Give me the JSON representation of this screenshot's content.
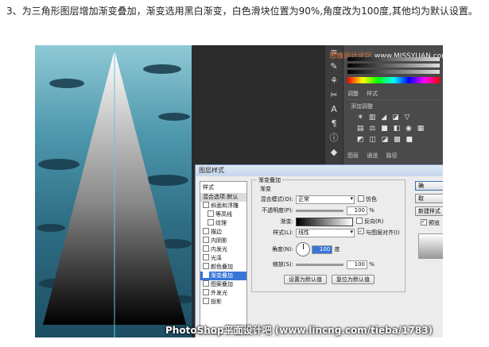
{
  "caption": "3、为三角形图层增加渐变叠加，渐变选用黑白渐变，白色滑块位置为90%,角度改为100度,其他均为默认设置。",
  "watermark_top": {
    "brand": "思缘设计论坛",
    "url": "www.MISSYUAN.com"
  },
  "right_panel": {
    "tabs": [
      "调整",
      "样式"
    ],
    "adjust_label": "添加调整",
    "layer_tabs": [
      "图层",
      "通道",
      "路径"
    ]
  },
  "dialog": {
    "title": "图层样式",
    "styles_header": "样式",
    "styles": [
      {
        "label": "混合选项:默认",
        "type": "blend",
        "checked": false
      },
      {
        "label": "斜面和浮雕",
        "type": "item",
        "checked": false
      },
      {
        "label": "等高线",
        "type": "sub",
        "checked": false
      },
      {
        "label": "纹理",
        "type": "sub",
        "checked": false
      },
      {
        "label": "描边",
        "type": "item",
        "checked": false
      },
      {
        "label": "内阴影",
        "type": "item",
        "checked": false
      },
      {
        "label": "内发光",
        "type": "item",
        "checked": false
      },
      {
        "label": "光泽",
        "type": "item",
        "checked": false
      },
      {
        "label": "颜色叠加",
        "type": "item",
        "checked": false
      },
      {
        "label": "渐变叠加",
        "type": "selected",
        "checked": true
      },
      {
        "label": "图案叠加",
        "type": "item",
        "checked": false
      },
      {
        "label": "外发光",
        "type": "item",
        "checked": false
      },
      {
        "label": "投影",
        "type": "item",
        "checked": false
      }
    ],
    "group_title": "渐变叠加",
    "sub_title": "渐变",
    "blend_mode_label": "混合模式(O):",
    "blend_mode_value": "正常",
    "dither_label": "仿色",
    "opacity_label": "不透明度(P):",
    "opacity_value": "100",
    "percent": "%",
    "gradient_label": "渐变:",
    "reverse_label": "反向(R)",
    "style_label": "样式(L):",
    "style_value": "线性",
    "align_label": "与图层对齐(I)",
    "angle_label": "角度(N):",
    "angle_value": "100",
    "degree": "度",
    "scale_label": "缩放(S):",
    "scale_value": "100",
    "set_default": "设置为默认值",
    "reset_default": "复位为默认值",
    "right_buttons": [
      "确",
      "取",
      "新建样式",
      "预览"
    ]
  },
  "bottom_watermark": "PhotoShop平面设计吧 (www.lincng.com/tieba/1783)"
}
